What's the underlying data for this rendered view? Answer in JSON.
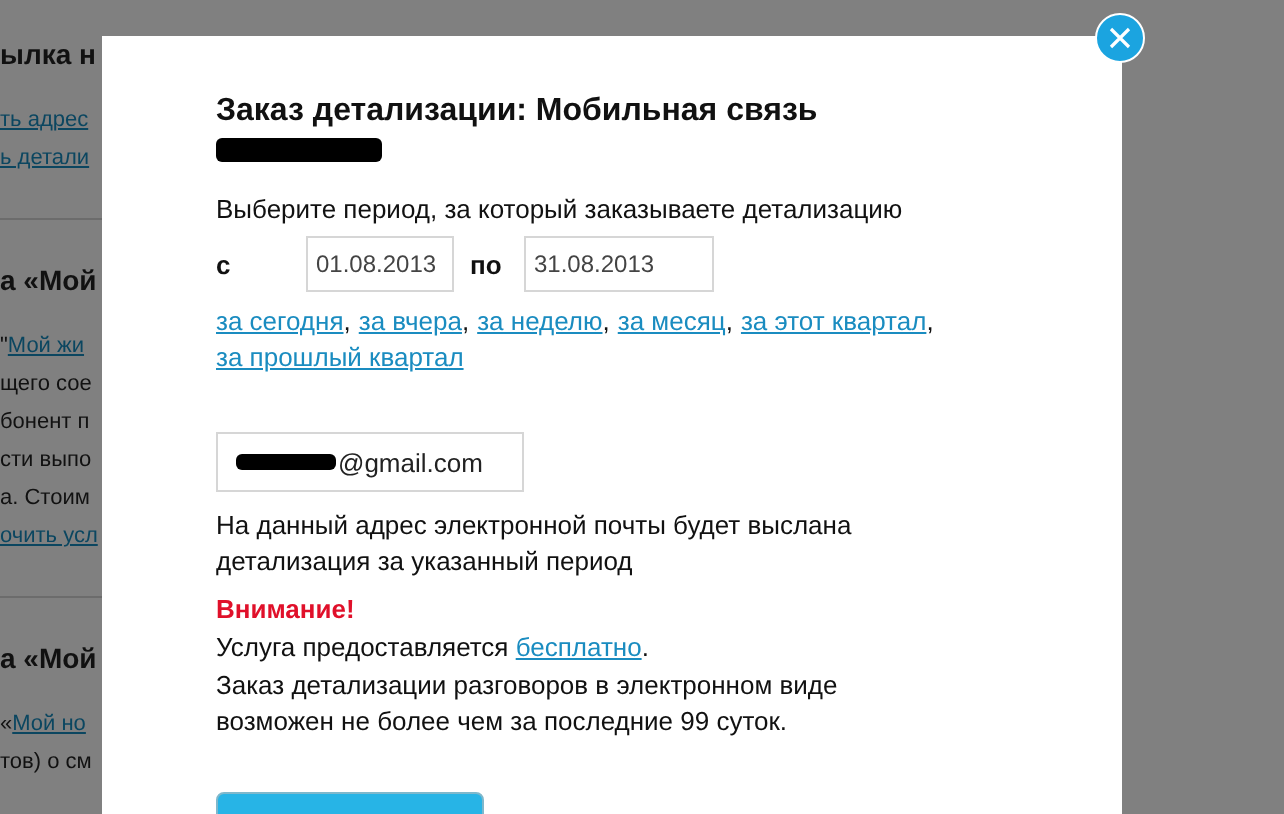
{
  "background_page": {
    "lines": [
      {
        "kind": "heading",
        "text": "ылка н"
      },
      {
        "kind": "link",
        "text": "ть адрес"
      },
      {
        "kind": "link",
        "text": "ь детали"
      },
      {
        "kind": "divider"
      },
      {
        "kind": "heading",
        "text": "а «Мой"
      },
      {
        "kind": "mixed",
        "text": "\"",
        "link_text": "Мой жи"
      },
      {
        "kind": "text",
        "text": "щего сое"
      },
      {
        "kind": "text",
        "text": "бонент п"
      },
      {
        "kind": "text",
        "text": "сти выпо"
      },
      {
        "kind": "text",
        "text": "а. Стоим"
      },
      {
        "kind": "link",
        "text": "очить усл"
      },
      {
        "kind": "divider"
      },
      {
        "kind": "heading",
        "text": "а «Мой"
      },
      {
        "kind": "mixed",
        "text": "«",
        "link_text": "Мой но"
      },
      {
        "kind": "text",
        "text": "тов) о см"
      }
    ]
  },
  "dialog": {
    "title": "Заказ детализации: Мобильная связь",
    "number_redacted": true,
    "period_prompt": "Выберите период, за который заказываете детализацию",
    "from_label": "с",
    "from_value": "01.08.2013",
    "to_label": "по",
    "to_value": "31.08.2013",
    "quick_links": [
      {
        "text": "за сегодня",
        "separator": ","
      },
      {
        "text": "за вчера",
        "separator": ","
      },
      {
        "text": "за неделю",
        "separator": ","
      },
      {
        "text": "за месяц",
        "separator": ","
      },
      {
        "text": "за этот квартал",
        "separator": ","
      },
      {
        "text": "за прошлый квартал"
      }
    ],
    "email": {
      "prefix_redacted": true,
      "value": "@gmail.com"
    },
    "email_note": "На данный адрес электронной почты будет выслана детализация за указанный период",
    "warning_title": "Внимание!",
    "service_text": "Услуга предоставляется ",
    "service_link": "бесплатно",
    "service_suffix": ".",
    "limit_text": "Заказ детализации разговоров в электронном виде возможен не более чем за последние 99 суток.",
    "footer_button": {
      "kind": "primary"
    }
  }
}
